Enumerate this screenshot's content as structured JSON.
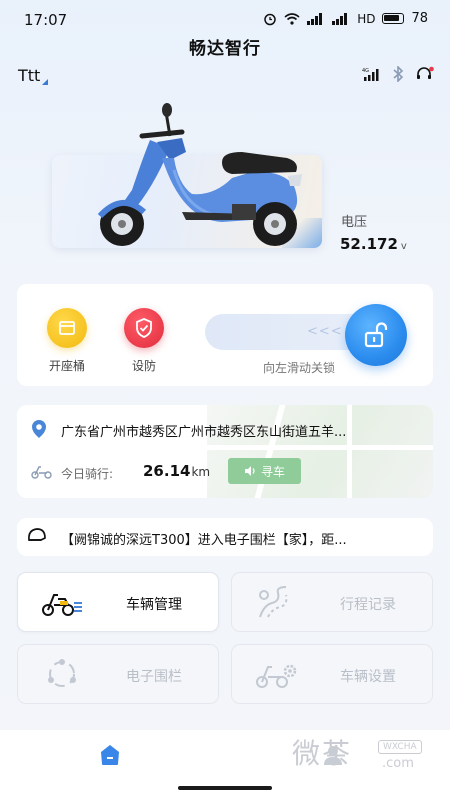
{
  "status_bar": {
    "time": "17:07",
    "network": "HD",
    "battery": "78"
  },
  "header": {
    "title": "畅达智行"
  },
  "user": {
    "name": "Ttt"
  },
  "vehicle": {
    "voltage_label": "电压",
    "voltage_value": "52.172",
    "voltage_unit": "v"
  },
  "controls": {
    "seat_label": "开座桶",
    "arm_label": "设防",
    "slider_arrows": "<<<",
    "slider_caption": "向左滑动关锁"
  },
  "location": {
    "address": "广东省广州市越秀区广州市越秀区东山街道五羊...",
    "trip_label": "今日骑行:",
    "trip_value": "26.14",
    "trip_unit": "km",
    "find_car_label": "寻车"
  },
  "notice": {
    "text": "【阙锦诚的深远T300】进入电子围栏【家】，距..."
  },
  "menu": {
    "vehicle_manage": "车辆管理",
    "trip_record": "行程记录",
    "geofence": "电子围栏",
    "vehicle_settings": "车辆设置"
  },
  "watermark": {
    "big": "微茶",
    "small": "WXCHA",
    "com": ".com"
  },
  "colors": {
    "accent": "#2b8cee",
    "seat_button": "#f5c518",
    "arm_button": "#e8394a",
    "find_car": "#8fcc9a"
  },
  "icons": {
    "seat": "seat-box-icon",
    "arm": "shield-icon",
    "unlock": "padlock-open-icon",
    "location": "location-pin-icon",
    "trip": "scooter-icon",
    "find_car": "speaker-icon",
    "notice": "helmet-icon",
    "home_nav": "home-icon",
    "user_nav": "user-icon"
  }
}
